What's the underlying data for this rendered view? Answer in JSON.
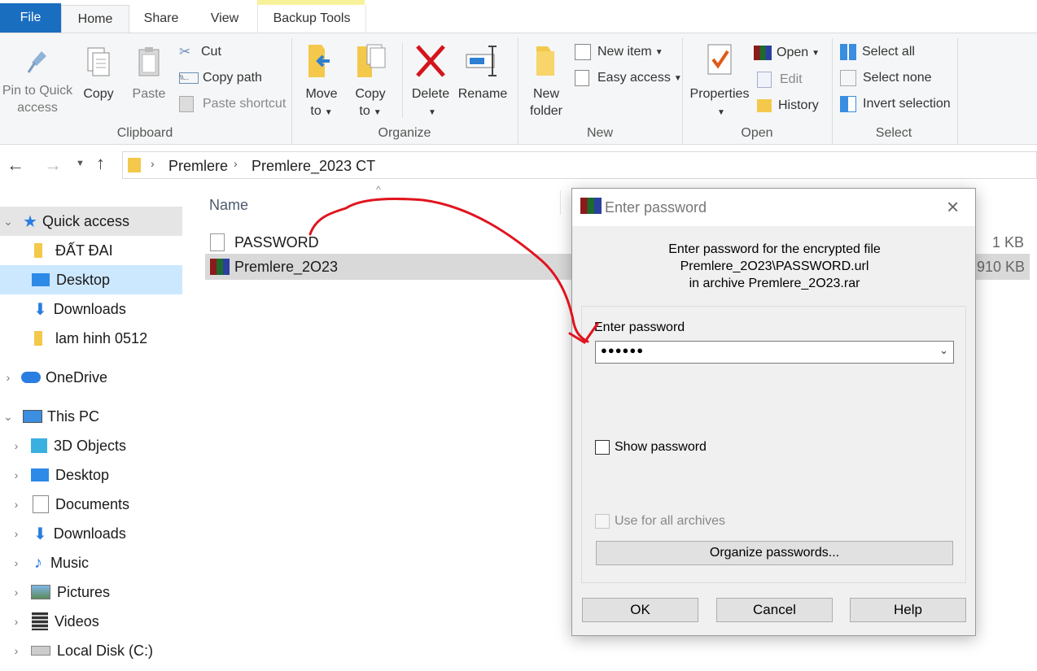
{
  "ribbon": {
    "tabs": {
      "file": "File",
      "home": "Home",
      "share": "Share",
      "view": "View",
      "backup": "Backup Tools"
    },
    "clipboard": {
      "pin_line1": "Pin to Quick",
      "pin_line2": "access",
      "copy": "Copy",
      "paste": "Paste",
      "cut": "Cut",
      "copy_path": "Copy path",
      "paste_shortcut": "Paste shortcut",
      "group": "Clipboard"
    },
    "organize": {
      "move1": "Move",
      "move2": "to",
      "copy1": "Copy",
      "copy2": "to",
      "delete": "Delete",
      "rename": "Rename",
      "group": "Organize"
    },
    "new": {
      "folder1": "New",
      "folder2": "folder",
      "new_item": "New item",
      "easy_access": "Easy access",
      "group": "New"
    },
    "open": {
      "properties": "Properties",
      "open": "Open",
      "edit": "Edit",
      "history": "History",
      "group": "Open"
    },
    "select": {
      "all": "Select all",
      "none": "Select none",
      "invert": "Invert selection",
      "group": "Select"
    }
  },
  "address": {
    "crumbs": [
      "Premlere",
      "Premlere_2023 CT"
    ]
  },
  "nav": {
    "quick_access": "Quick access",
    "quick_items": [
      "ĐẤT ĐAI",
      "Desktop",
      "Downloads",
      "lam hinh 0512"
    ],
    "onedrive": "OneDrive",
    "this_pc": "This PC",
    "pc_items": [
      "3D Objects",
      "Desktop",
      "Documents",
      "Downloads",
      "Music",
      "Pictures",
      "Videos",
      "Local Disk (C:)"
    ]
  },
  "files": {
    "col_name": "Name",
    "rows": [
      {
        "name": "PASSWORD",
        "size": "1 KB"
      },
      {
        "name": "Premlere_2O23",
        "size": ",910 KB"
      }
    ]
  },
  "dialog": {
    "title": "Enter password",
    "msg1": "Enter password for the encrypted file",
    "msg2": "Premlere_2O23\\PASSWORD.url",
    "msg3": "in archive Premlere_2O23.rar",
    "field_label": "Enter password",
    "password_value": "●●●●●●",
    "show_password": "Show password",
    "use_all": "Use for all archives",
    "organize": "Organize passwords...",
    "ok": "OK",
    "cancel": "Cancel",
    "help": "Help"
  },
  "colors": {
    "accent": "#1a6ec0",
    "selection": "#cce8ff",
    "annotation": "#e0141e"
  }
}
